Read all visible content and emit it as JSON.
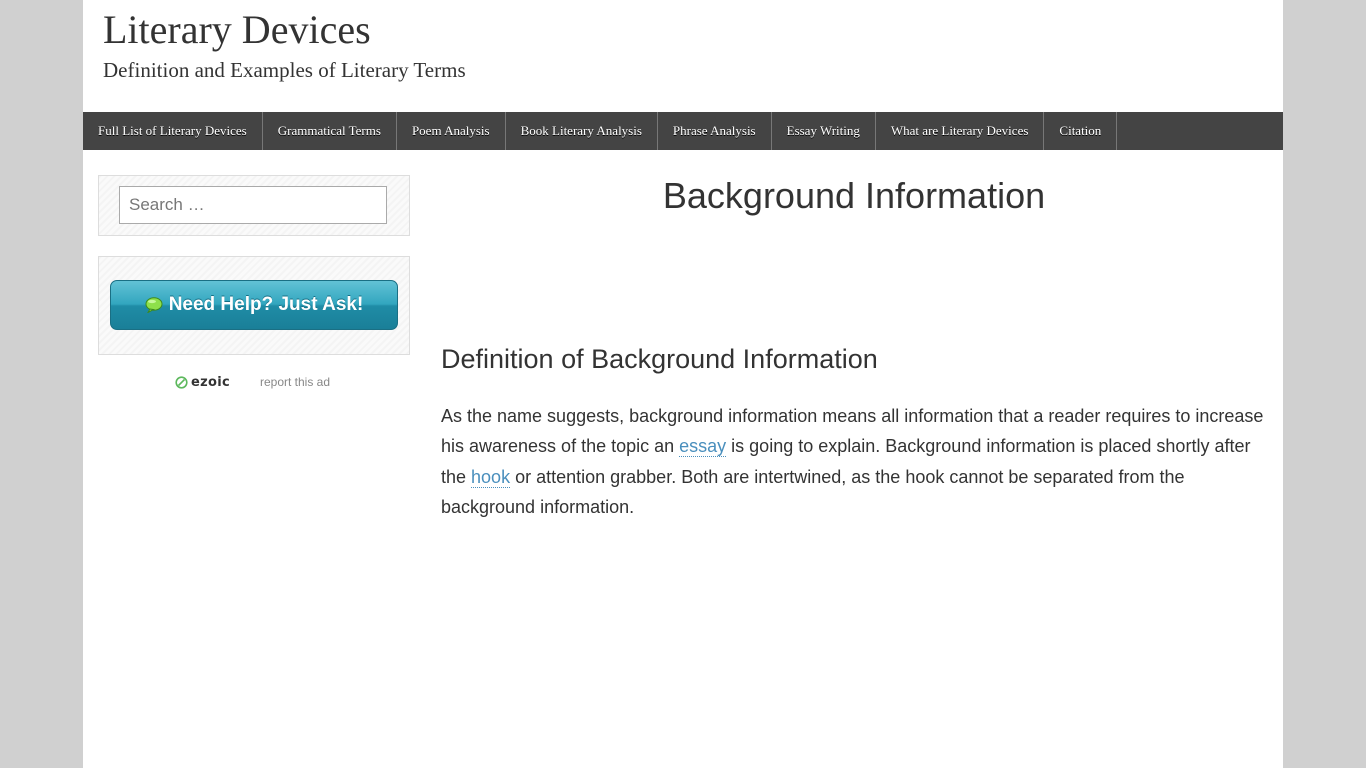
{
  "site": {
    "title": "Literary Devices",
    "description": "Definition and Examples of Literary Terms"
  },
  "nav": {
    "items": [
      "Full List of Literary Devices",
      "Grammatical Terms",
      "Poem Analysis",
      "Book Literary Analysis",
      "Phrase Analysis",
      "Essay Writing",
      "What are Literary Devices",
      "Citation"
    ]
  },
  "sidebar": {
    "search": {
      "placeholder": "Search …"
    },
    "help_button": {
      "label": "Need Help? Just Ask!",
      "icon": "speech-bubble-icon"
    },
    "ad": {
      "brand": "ezoic",
      "report_label": "report this ad"
    }
  },
  "article": {
    "title": "Background Information",
    "section_heading": "Definition of Background Information",
    "body": {
      "part1": "As the name suggests, background information means all information that a reader requires to increase his awareness of the topic an ",
      "link1": "essay",
      "part2": " is going to explain. Background information is placed shortly after the ",
      "link2": "hook",
      "part3": " or attention grabber. Both are intertwined, as the hook cannot be separated from the background information."
    }
  },
  "colors": {
    "nav_bg": "#444444",
    "link": "#4a8fbd",
    "button_teal": "#2a9ab4",
    "page_bg": "#d0d0d0"
  }
}
